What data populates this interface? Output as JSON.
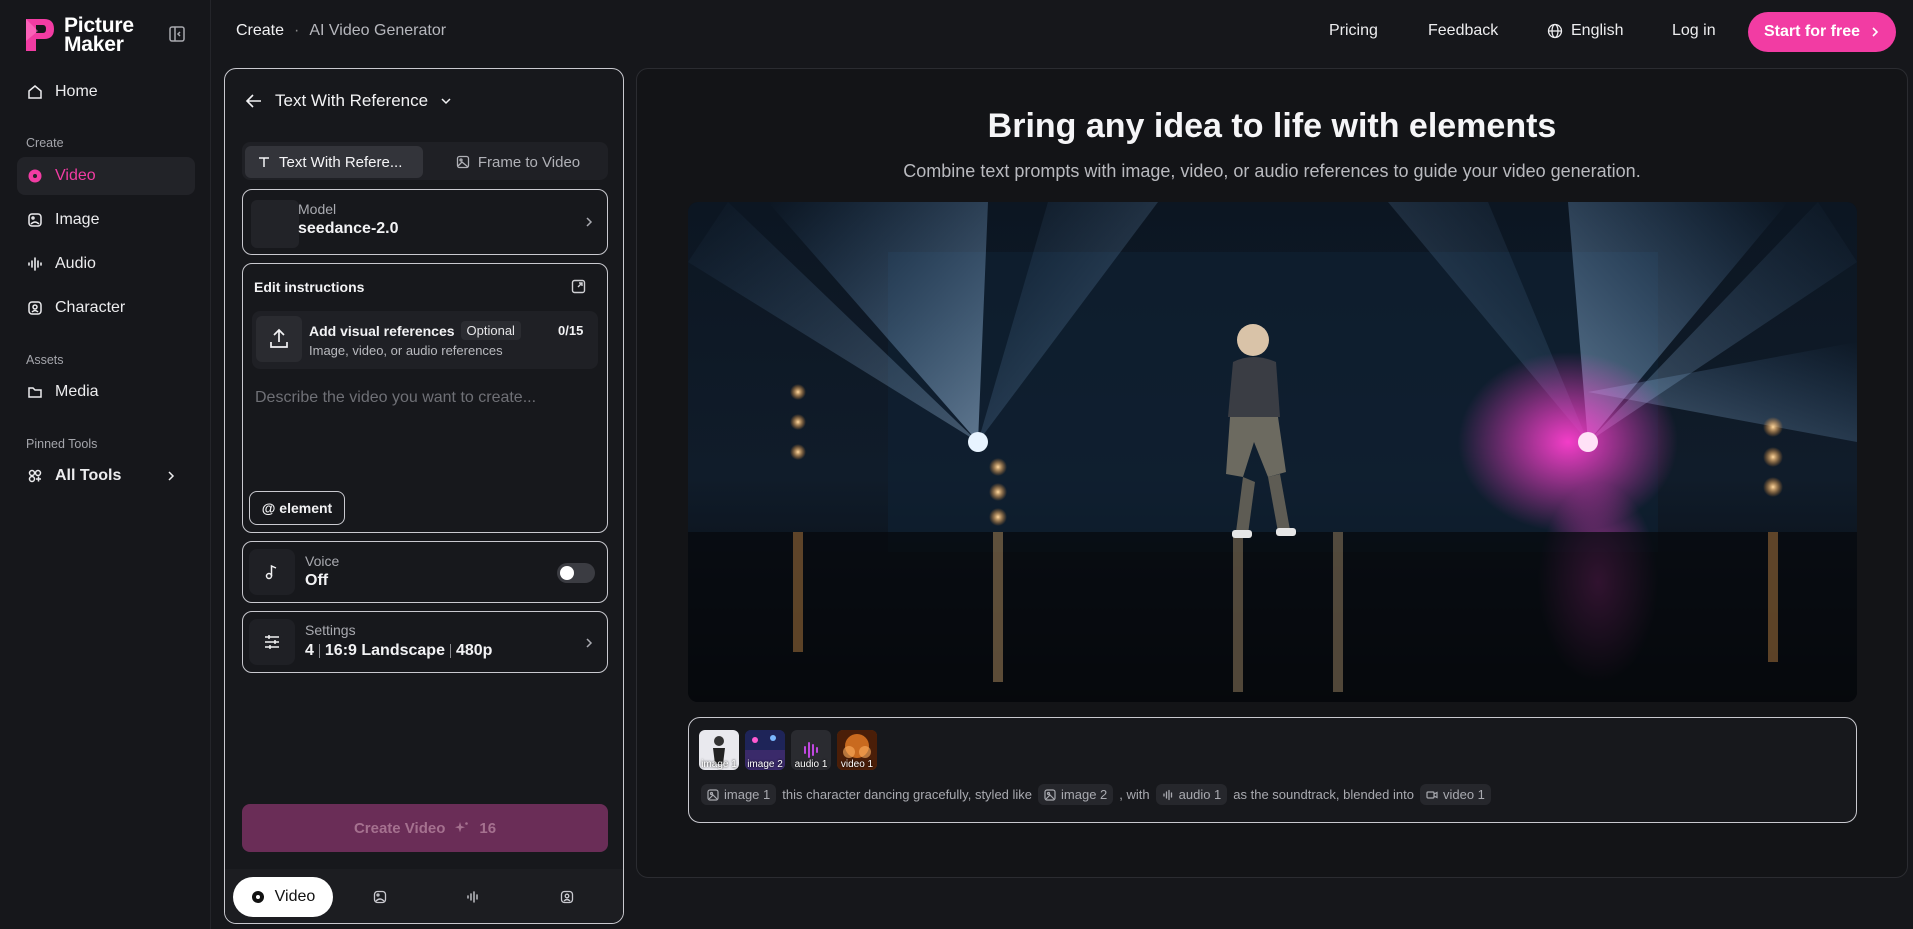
{
  "brand": {
    "name_line1": "Picture",
    "name_line2": "Maker",
    "accent": "#f23ca3"
  },
  "sidebar": {
    "home": "Home",
    "create_section": "Create",
    "create_items": [
      "Video",
      "Image",
      "Audio",
      "Character"
    ],
    "assets_section": "Assets",
    "media": "Media",
    "pinned_section": "Pinned Tools",
    "all_tools": "All Tools"
  },
  "topbar": {
    "breadcrumb_1": "Create",
    "breadcrumb_sep": "·",
    "breadcrumb_2": "AI Video Generator",
    "pricing": "Pricing",
    "feedback": "Feedback",
    "language": "English",
    "login": "Log in",
    "cta": "Start for free"
  },
  "panel": {
    "title": "Text With Reference",
    "tabs": [
      "Text With Refere...",
      "Frame to Video"
    ],
    "model_label": "Model",
    "model_value": "seedance-2.0",
    "edit_title": "Edit instructions",
    "upload_title": "Add visual references",
    "upload_optional": "Optional",
    "upload_count": "0/15",
    "upload_sub": "Image, video, or audio references",
    "prompt_placeholder": "Describe the video you want to create...",
    "element_button": "@ element",
    "voice_label": "Voice",
    "voice_value": "Off",
    "settings_label": "Settings",
    "settings_count": "4",
    "settings_ratio": "16:9 Landscape",
    "settings_res": "480p",
    "create_button": "Create Video",
    "create_cost": "16",
    "bottom_tab": "Video"
  },
  "main": {
    "title": "Bring any idea to life with elements",
    "subtitle": "Combine text prompts with image, video, or audio references to guide your video generation.",
    "thumbs": [
      "image 1",
      "image 2",
      "audio 1",
      "video 1"
    ],
    "prompt": {
      "chip1": "image 1",
      "t1": "this character dancing gracefully, styled like",
      "chip2": "image 2",
      "t2": ", with",
      "chip3": "audio 1",
      "t3": "as the soundtrack, blended into",
      "chip4": "video 1"
    }
  }
}
